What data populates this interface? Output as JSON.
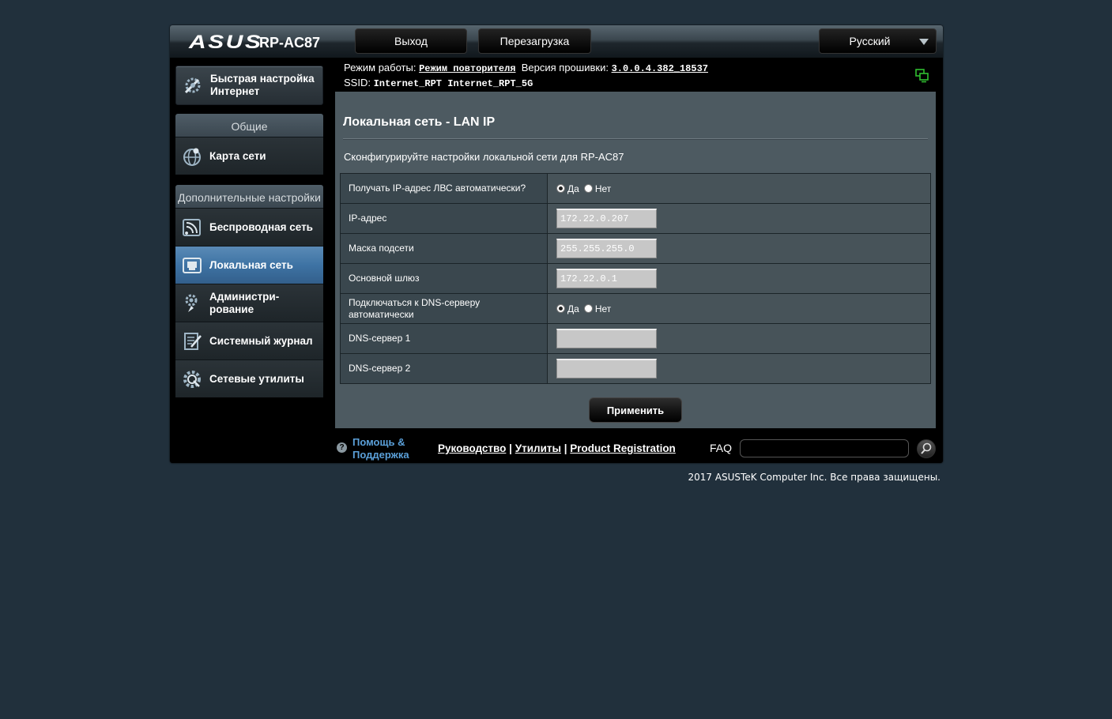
{
  "header": {
    "brand": "ASUS",
    "model": "RP-AC87",
    "logout_label": "Выход",
    "reboot_label": "Перезагрузка",
    "language": "Русский"
  },
  "infobar": {
    "mode_label": "Режим работы:",
    "mode_value": "Режим повторителя",
    "firmware_label": "Версия прошивки:",
    "firmware_value": "3.0.0.4.382_18537",
    "ssid_label": "SSID:",
    "ssid_values": [
      "Internet_RPT",
      "Internet_RPT_5G"
    ]
  },
  "sidebar": {
    "quick_setup": "Быстрая настройка Интернет",
    "general_title": "Общие",
    "general_items": [
      {
        "label": "Карта сети",
        "icon": "network-map-icon"
      }
    ],
    "advanced_title": "Дополнительные настройки",
    "advanced_items": [
      {
        "label": "Беспроводная сеть",
        "icon": "wireless-icon"
      },
      {
        "label": "Локальная сеть",
        "icon": "lan-icon",
        "active": true
      },
      {
        "label": "Администри-рование",
        "icon": "administration-icon"
      },
      {
        "label": "Системный журнал",
        "icon": "system-log-icon"
      },
      {
        "label": "Сетевые утилиты",
        "icon": "network-tools-icon"
      }
    ]
  },
  "content": {
    "title": "Локальная сеть - LAN IP",
    "description": "Сконфигурируйте настройки локальной сети для RP-AC87",
    "rows": {
      "auto_ip": {
        "label": "Получать IP-адрес ЛВС автоматически?",
        "yes": "Да",
        "no": "Нет",
        "selected": "yes"
      },
      "ip": {
        "label": "IP-адрес",
        "value": "172.22.0.207"
      },
      "mask": {
        "label": "Маска подсети",
        "value": "255.255.255.0"
      },
      "gateway": {
        "label": "Основной шлюз",
        "value": "172.22.0.1"
      },
      "auto_dns": {
        "label": "Подключаться к DNS-серверу автоматически",
        "yes": "Да",
        "no": "Нет",
        "selected": "yes"
      },
      "dns1": {
        "label": "DNS-сервер 1",
        "value": ""
      },
      "dns2": {
        "label": "DNS-сервер 2",
        "value": ""
      }
    },
    "apply_label": "Применить"
  },
  "footer": {
    "help_line1": "Помощь &",
    "help_line2": "Поддержка",
    "links": [
      "Руководство",
      "Утилиты",
      "Product Registration"
    ],
    "faq_label": "FAQ"
  },
  "copyright": "2017 ASUSTeK Computer Inc. Все права защищены.",
  "colors": {
    "page_bg": "#21303c",
    "content_bg": "#4d5a61",
    "active_menu": "#3e73a4",
    "help_link": "#5ba0d9"
  }
}
